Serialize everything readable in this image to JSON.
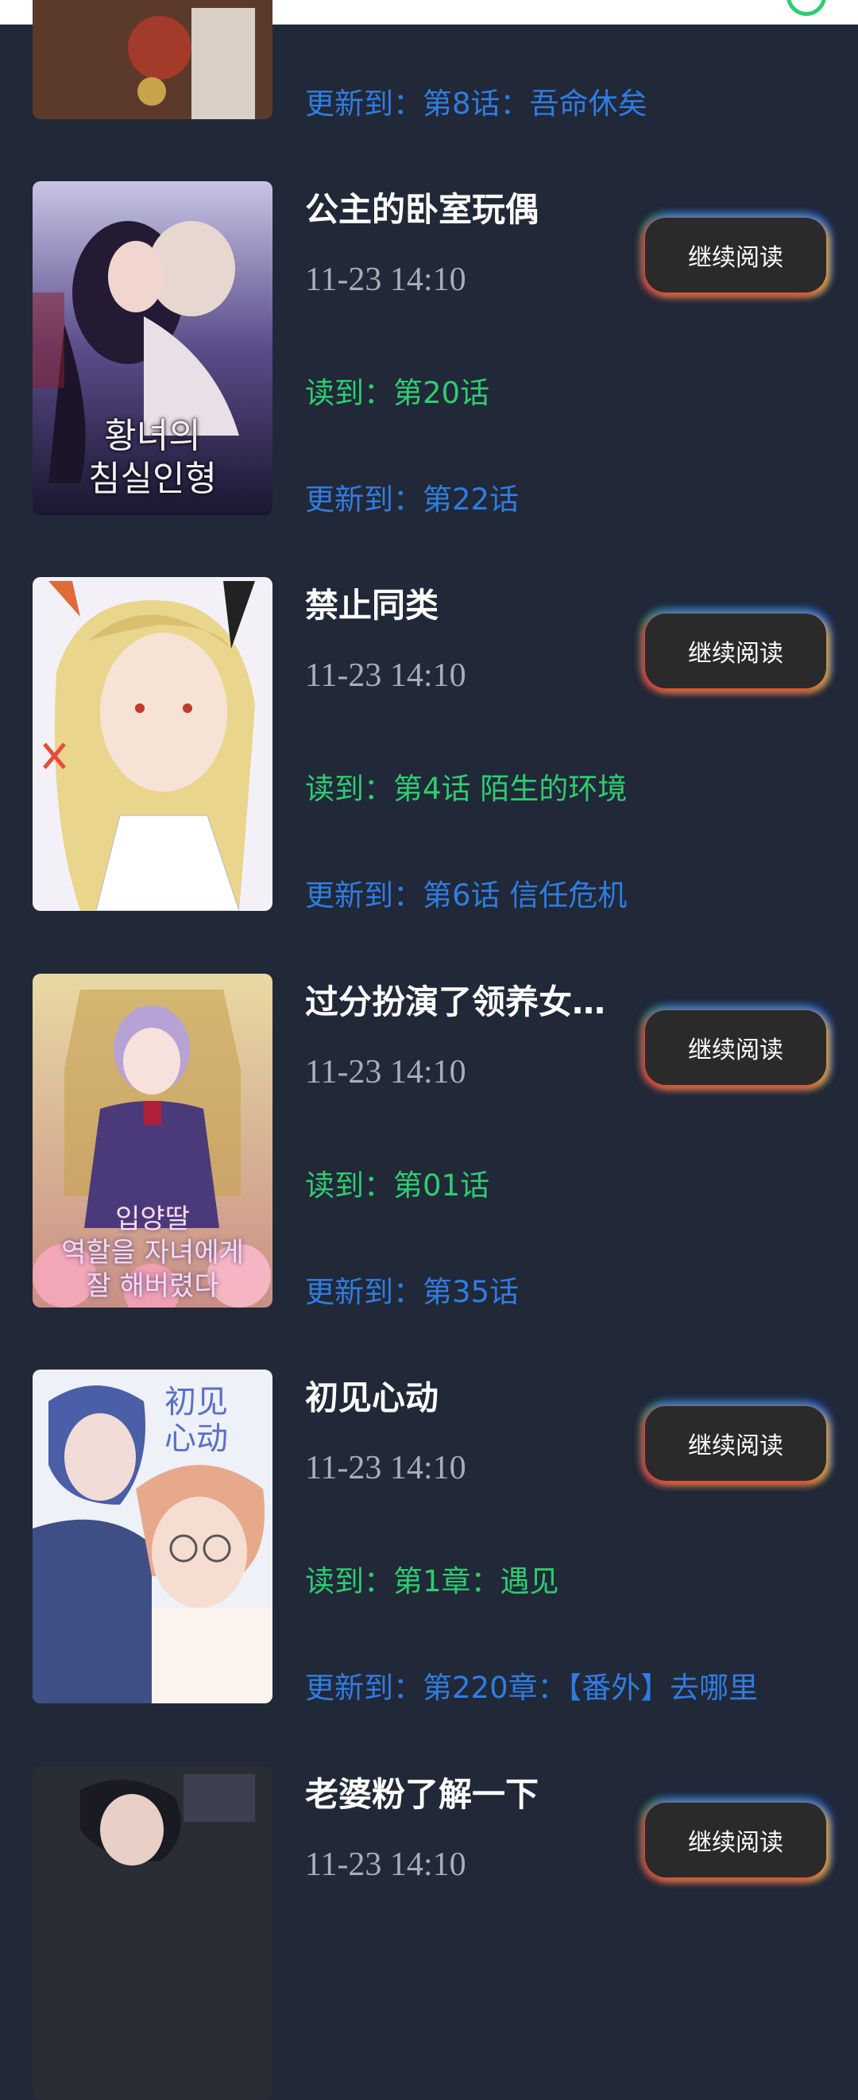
{
  "items": [
    {
      "title": "",
      "time": "",
      "read": "",
      "update": "更新到：第8话：吾命休矣"
    },
    {
      "title": "公主的卧室玩偶",
      "time": "11-23 14:10",
      "read": "读到：第20话",
      "update": "更新到：第22话",
      "cover_text": "황녀의\n침실인형",
      "button": "继续阅读"
    },
    {
      "title": "禁止同类",
      "time": "11-23 14:10",
      "read": "读到：第4话 陌生的环境",
      "update": "更新到：第6话 信任危机",
      "button": "继续阅读"
    },
    {
      "title": "过分扮演了领养女…",
      "time": "11-23 14:10",
      "read": "读到：第01话",
      "update": "更新到：第35话",
      "cover_text": "입양딸\n역할을 자녀에게\n잘 해버렸다",
      "button": "继续阅读"
    },
    {
      "title": "初见心动",
      "time": "11-23 14:10",
      "read": "读到：第1章：遇见",
      "update": "更新到：第220章：【番外】去哪里",
      "cover_text": "初见\n心动",
      "button": "继续阅读"
    },
    {
      "title": "老婆粉了解一下",
      "time": "11-23 14:10",
      "button": "继续阅读"
    }
  ],
  "colors": {
    "background": "#212838",
    "read": "#2ecc71",
    "update": "#2f7de1",
    "button": "#2a2a2b"
  }
}
